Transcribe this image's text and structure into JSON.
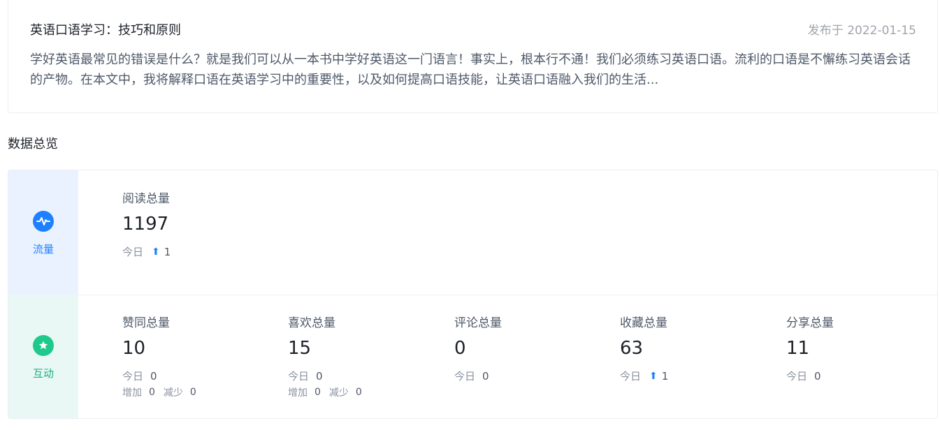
{
  "article": {
    "title": "英语口语学习：技巧和原则",
    "date": "发布于 2022-01-15",
    "excerpt": "学好英语最常见的错误是什么？就是我们可以从一本书中学好英语这一门语言！事实上，根本行不通！我们必须练习英语口语。流利的口语是不懈练习英语会话的产物。在本文中，我将解释口语在英语学习中的重要性，以及如何提高口语技能，让英语口语融入我们的生活..."
  },
  "overview": {
    "title": "数据总览",
    "traffic": {
      "label": "流量",
      "icon": "pulse-icon",
      "color": "#1e80ff",
      "metrics": [
        {
          "label": "阅读总量",
          "value": "1197",
          "today_label": "今日",
          "today_trend": "up",
          "today_value": "1"
        }
      ]
    },
    "interaction": {
      "label": "互动",
      "icon": "star-chat-icon",
      "color": "#1fc98b",
      "metrics": [
        {
          "label": "赞同总量",
          "value": "10",
          "today_label": "今日",
          "today_value": "0",
          "add_label": "增加",
          "add_value": "0",
          "reduce_label": "减少",
          "reduce_value": "0"
        },
        {
          "label": "喜欢总量",
          "value": "15",
          "today_label": "今日",
          "today_value": "0",
          "add_label": "增加",
          "add_value": "0",
          "reduce_label": "减少",
          "reduce_value": "0"
        },
        {
          "label": "评论总量",
          "value": "0",
          "today_label": "今日",
          "today_value": "0"
        },
        {
          "label": "收藏总量",
          "value": "63",
          "today_label": "今日",
          "today_trend": "up",
          "today_value": "1"
        },
        {
          "label": "分享总量",
          "value": "11",
          "today_label": "今日",
          "today_value": "0"
        }
      ]
    }
  }
}
